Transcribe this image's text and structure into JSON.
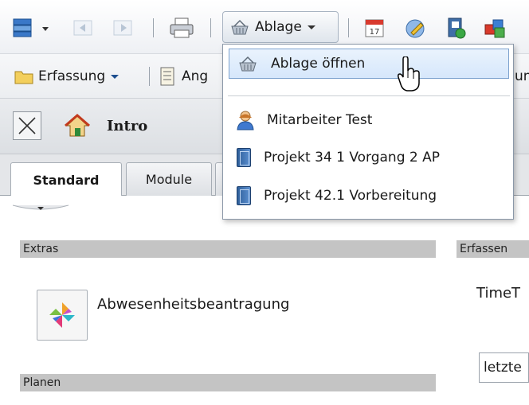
{
  "toolbar": {
    "ablage_label": "Ablage"
  },
  "toolbar2": {
    "erfassung_label": "Erfassung",
    "ang_label": "Ang",
    "cut_label": "un"
  },
  "header": {
    "title": "Intro"
  },
  "tabs": [
    {
      "label": "Standard"
    },
    {
      "label": "Module"
    }
  ],
  "dropdown": {
    "items": [
      {
        "label": "Ablage öffnen",
        "icon": "basket-icon"
      },
      {
        "label": "Mitarbeiter Test",
        "icon": "person-icon"
      },
      {
        "label": "Projekt 34 1 Vorgang 2 AP",
        "icon": "book-icon"
      },
      {
        "label": "Projekt 42.1 Vorbereitung",
        "icon": "book-icon"
      }
    ]
  },
  "sections": {
    "extras_label": "Extras",
    "planen_label": "Planen",
    "erfassen_label": "Erfassen",
    "abwesenheit_label": "Abwesenheitsbeantragung",
    "timet_label": "TimeT",
    "letzte_value": "letzte"
  },
  "colors": {
    "accent_blue": "#2f6fb8",
    "section_gray": "#c4c4c4",
    "hover_border": "#7da2ce"
  }
}
